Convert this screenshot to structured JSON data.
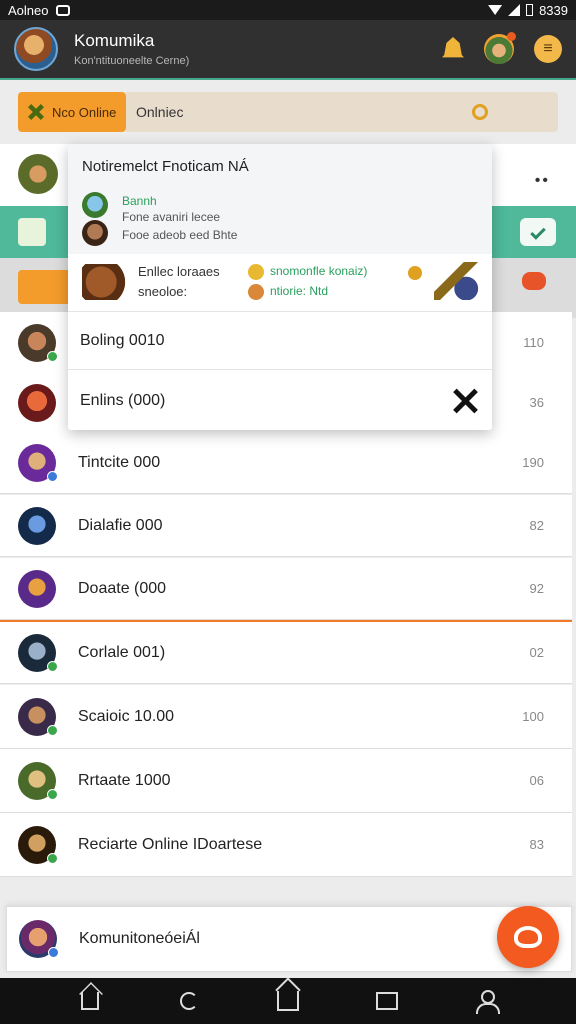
{
  "status_bar": {
    "left_label": "Aolneo",
    "time": "8339"
  },
  "header": {
    "title": "Komumika",
    "subtitle": "Kon'ntituoneelte Cerne)"
  },
  "filter": {
    "chip_label": "Nco Online",
    "input_value": "Onlniec"
  },
  "popup": {
    "title": "Notiremelct Fnoticam NÁ",
    "sender_name": "Bannh",
    "sender_line1": "Fone avaniri lecee",
    "sender_line2": "Fooe adeob eed Bhte",
    "attach_line1": "Enllec loraaes",
    "attach_line2": "sneoloe:",
    "attach_green1": "snomonfle konaiz)",
    "attach_green2": "ntiorie: Ntd",
    "items": [
      {
        "label": "Boling 0010"
      },
      {
        "label": "Enlins (000)"
      }
    ]
  },
  "list": {
    "rows": [
      {
        "name": "",
        "count": "110",
        "badge_color": "#3aa84a"
      },
      {
        "name": "",
        "count": "36",
        "badge_color": ""
      },
      {
        "name": "Tintcite 000",
        "count": "190",
        "badge_color": "#3a7ad8"
      },
      {
        "name": "Dialafie 000",
        "count": "82",
        "badge_color": ""
      },
      {
        "name": "Doaate (000",
        "count": "92",
        "badge_color": ""
      },
      {
        "name": "Corlale 001)",
        "count": "02",
        "badge_color": "#3aa84a"
      },
      {
        "name": "Scaioic 10.00",
        "count": "100",
        "badge_color": "#3aa84a"
      },
      {
        "name": "Rrtaate 1000",
        "count": "06",
        "badge_color": "#3aa84a"
      },
      {
        "name": "Reciarte Online IDoartese",
        "count": "83",
        "badge_color": "#3aa84a"
      }
    ]
  },
  "bottom_card": {
    "label": "KomunitoneóeiÁl"
  },
  "colors": {
    "accent_green": "#4fb99a",
    "accent_orange": "#f39b2b",
    "fab": "#f25a1f"
  },
  "icons": [
    "bell-icon",
    "hero-icon",
    "menu-icon",
    "close-icon",
    "home-icon",
    "refresh-icon",
    "house-icon",
    "inbox-icon",
    "user-icon"
  ]
}
